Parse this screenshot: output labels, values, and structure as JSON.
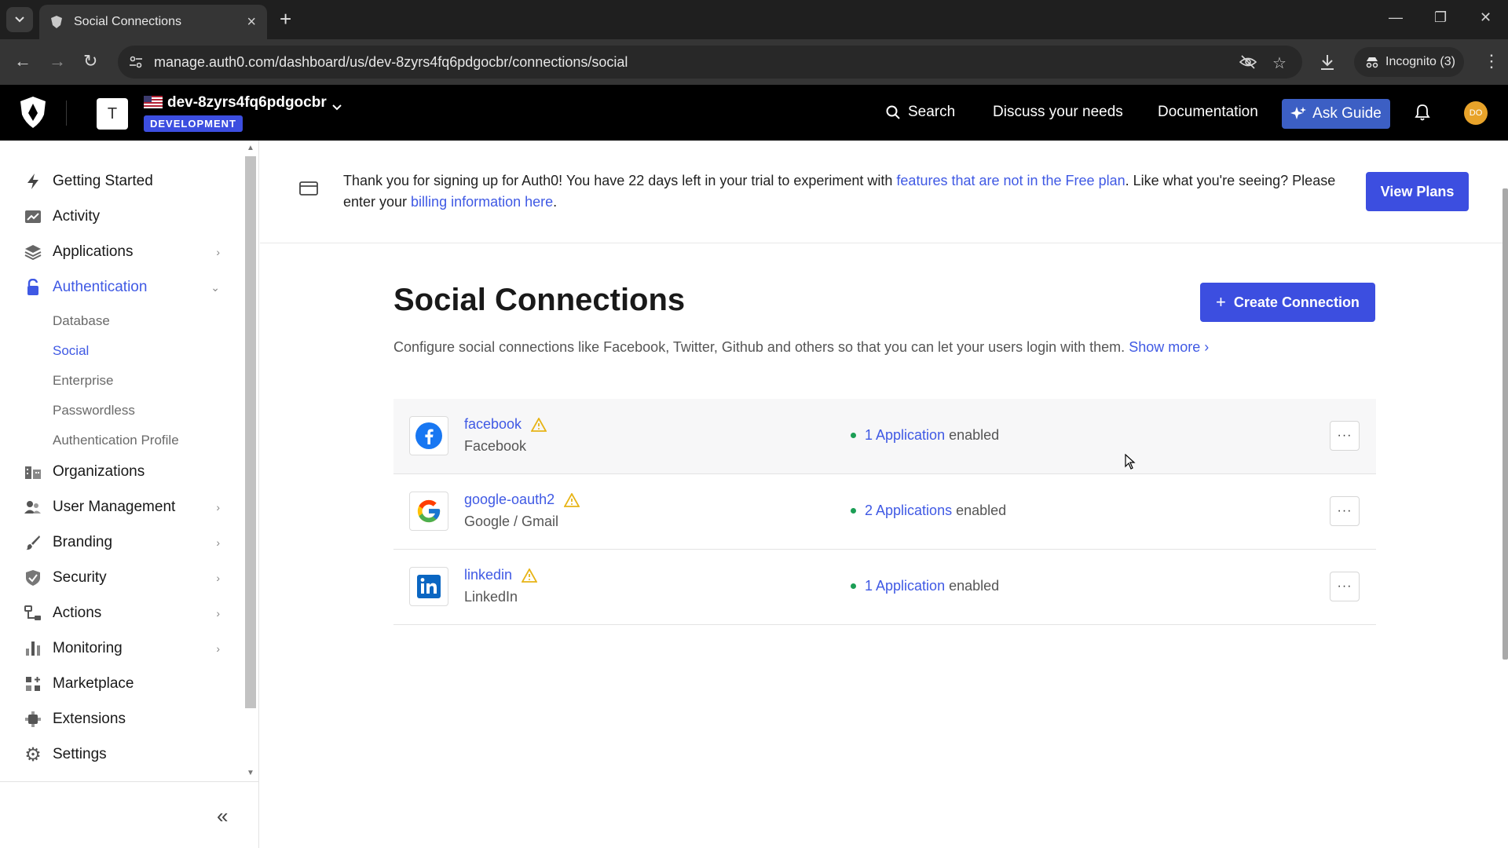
{
  "browser": {
    "tab_title": "Social Connections",
    "url": "manage.auth0.com/dashboard/us/dev-8zyrs4fq6pdgocbr/connections/social",
    "incognito_label": "Incognito (3)"
  },
  "header": {
    "tenant_initial": "T",
    "tenant_name": "dev-8zyrs4fq6pdgocbr",
    "tenant_env": "DEVELOPMENT",
    "search_label": "Search",
    "discuss_label": "Discuss your needs",
    "docs_label": "Documentation",
    "ask_guide_label": "Ask Guide",
    "avatar_initials": "DO"
  },
  "sidebar": {
    "items": [
      {
        "label": "Getting Started",
        "icon": "bolt-icon"
      },
      {
        "label": "Activity",
        "icon": "activity-chart-icon"
      },
      {
        "label": "Applications",
        "icon": "layers-icon"
      },
      {
        "label": "Authentication",
        "icon": "lock-icon"
      },
      {
        "label": "Organizations",
        "icon": "building-icon"
      },
      {
        "label": "User Management",
        "icon": "users-icon"
      },
      {
        "label": "Branding",
        "icon": "brush-icon"
      },
      {
        "label": "Security",
        "icon": "shield-check-icon"
      },
      {
        "label": "Actions",
        "icon": "flow-icon"
      },
      {
        "label": "Monitoring",
        "icon": "bar-chart-icon"
      },
      {
        "label": "Marketplace",
        "icon": "grid-plus-icon"
      },
      {
        "label": "Extensions",
        "icon": "extension-icon"
      },
      {
        "label": "Settings",
        "icon": "gear-icon"
      }
    ],
    "auth_subitems": [
      "Database",
      "Social",
      "Enterprise",
      "Passwordless",
      "Authentication Profile"
    ]
  },
  "banner": {
    "text_1": "Thank you for signing up for Auth0! You have 22 days left in your trial to experiment with ",
    "link_1": "features that are not in the Free plan",
    "text_2": ". Like what you're seeing? Please enter your ",
    "link_2": "billing information here",
    "text_3": ".",
    "button": "View Plans"
  },
  "main": {
    "title": "Social Connections",
    "create_button": "Create Connection",
    "description": "Configure social connections like Facebook, Twitter, Github and others so that you can let your users login with them.",
    "show_more": "Show more",
    "connections": [
      {
        "name": "facebook",
        "provider": "Facebook",
        "apps_link": "1 Application",
        "apps_suffix": "enabled"
      },
      {
        "name": "google-oauth2",
        "provider": "Google / Gmail",
        "apps_link": "2 Applications",
        "apps_suffix": "enabled"
      },
      {
        "name": "linkedin",
        "provider": "LinkedIn",
        "apps_link": "1 Application",
        "apps_suffix": "enabled"
      }
    ],
    "more_label": "···"
  },
  "colors": {
    "accent": "#3f59e4",
    "primary_button": "#3c4ee0",
    "status_green": "#1b9e55",
    "warning_yellow": "#e7b416"
  }
}
